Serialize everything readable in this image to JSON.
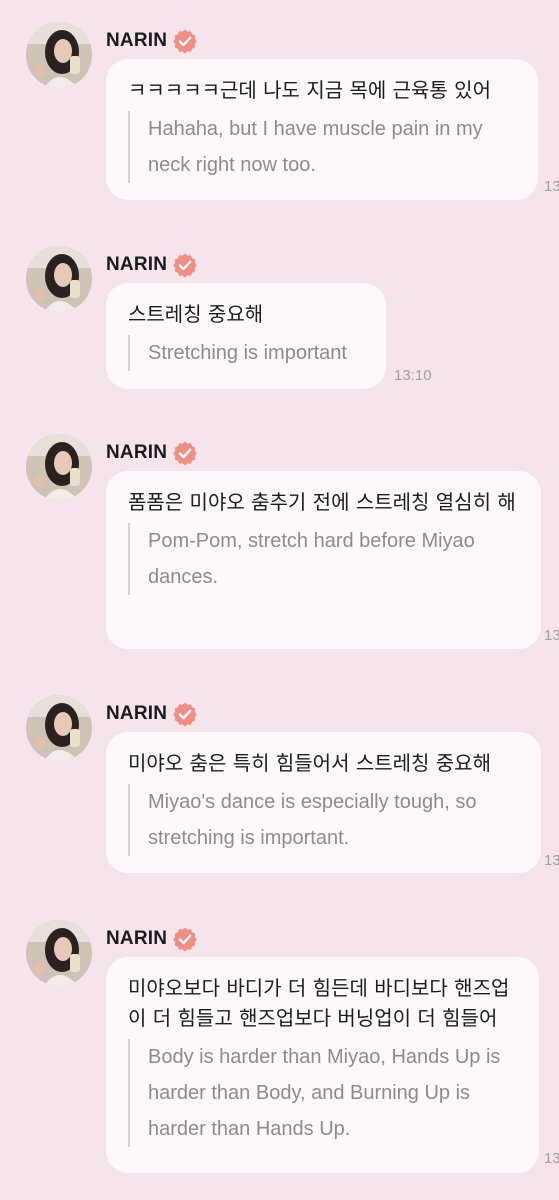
{
  "messages": [
    {
      "sender": "NARIN",
      "korean": "ㅋㅋㅋㅋㅋ근데 나도 지금 목에 근육통 있어",
      "english": "Hahaha, but I have muscle pain in my neck right now too.",
      "time": "13"
    },
    {
      "sender": "NARIN",
      "korean": "스트레칭 중요해",
      "english": "Stretching is important",
      "time": "13:10"
    },
    {
      "sender": "NARIN",
      "korean": "폼폼은 미야오 춤추기 전에 스트레칭 열심히 해",
      "english": "Pom-Pom, stretch hard before Miyao dances.",
      "time": "13"
    },
    {
      "sender": "NARIN",
      "korean": "미야오 춤은 특히 힘들어서 스트레칭 중요해",
      "english": "Miyao's dance is especially tough, so stretching is important.",
      "time": "13"
    },
    {
      "sender": "NARIN",
      "korean": "미야오보다 바디가 더 힘든데 바디보다 핸즈업이 더 힘들고 핸즈업보다 버닝업이 더 힘들어",
      "english": "Body is harder than Miyao, Hands Up is harder than Body, and Burning Up is harder than Hands Up.",
      "time": "13"
    }
  ],
  "icons": {
    "verified": "verified-badge-icon",
    "avatar": "profile-photo"
  },
  "colors": {
    "background": "#f5e4ec",
    "bubble": "#fdf8fa",
    "verified_badge": "#ef8f84",
    "translation_text": "#8f8b8d"
  }
}
